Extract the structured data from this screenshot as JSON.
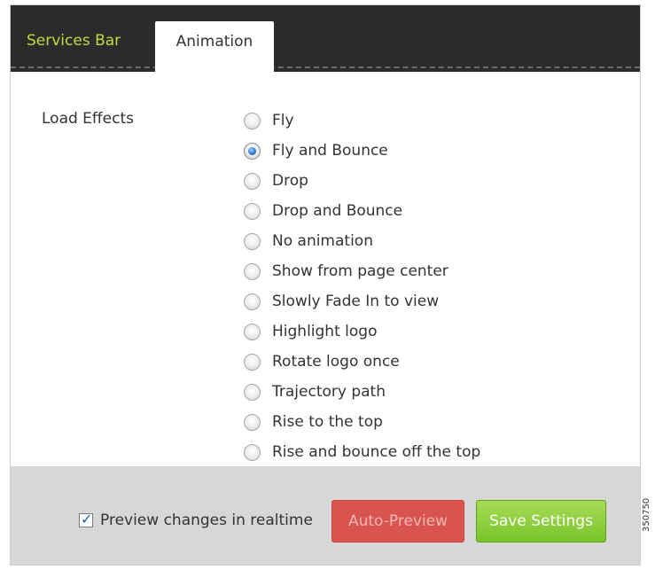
{
  "tabs": [
    {
      "label": "Services Bar",
      "active": false
    },
    {
      "label": "Animation",
      "active": true
    }
  ],
  "load_effects": {
    "label": "Load Effects",
    "selected": "Fly and Bounce",
    "options": [
      "Fly",
      "Fly and Bounce",
      "Drop",
      "Drop and Bounce",
      "No animation",
      "Show from page center",
      "Slowly Fade In to view",
      "Highlight logo",
      "Rotate logo once",
      "Trajectory path",
      "Rise to the top",
      "Rise and bounce off the top"
    ]
  },
  "footer": {
    "preview_label": "Preview changes in realtime",
    "preview_checked": true,
    "auto_preview_label": "Auto-Preview",
    "save_label": "Save Settings"
  },
  "figure_id": "350750",
  "colors": {
    "tabbar": "#2b2b2b",
    "inactive_tab_text": "#c2da3a",
    "auto_preview_button": "#d9534f",
    "save_button": "#79c42b",
    "footer": "#d7d7d7"
  }
}
